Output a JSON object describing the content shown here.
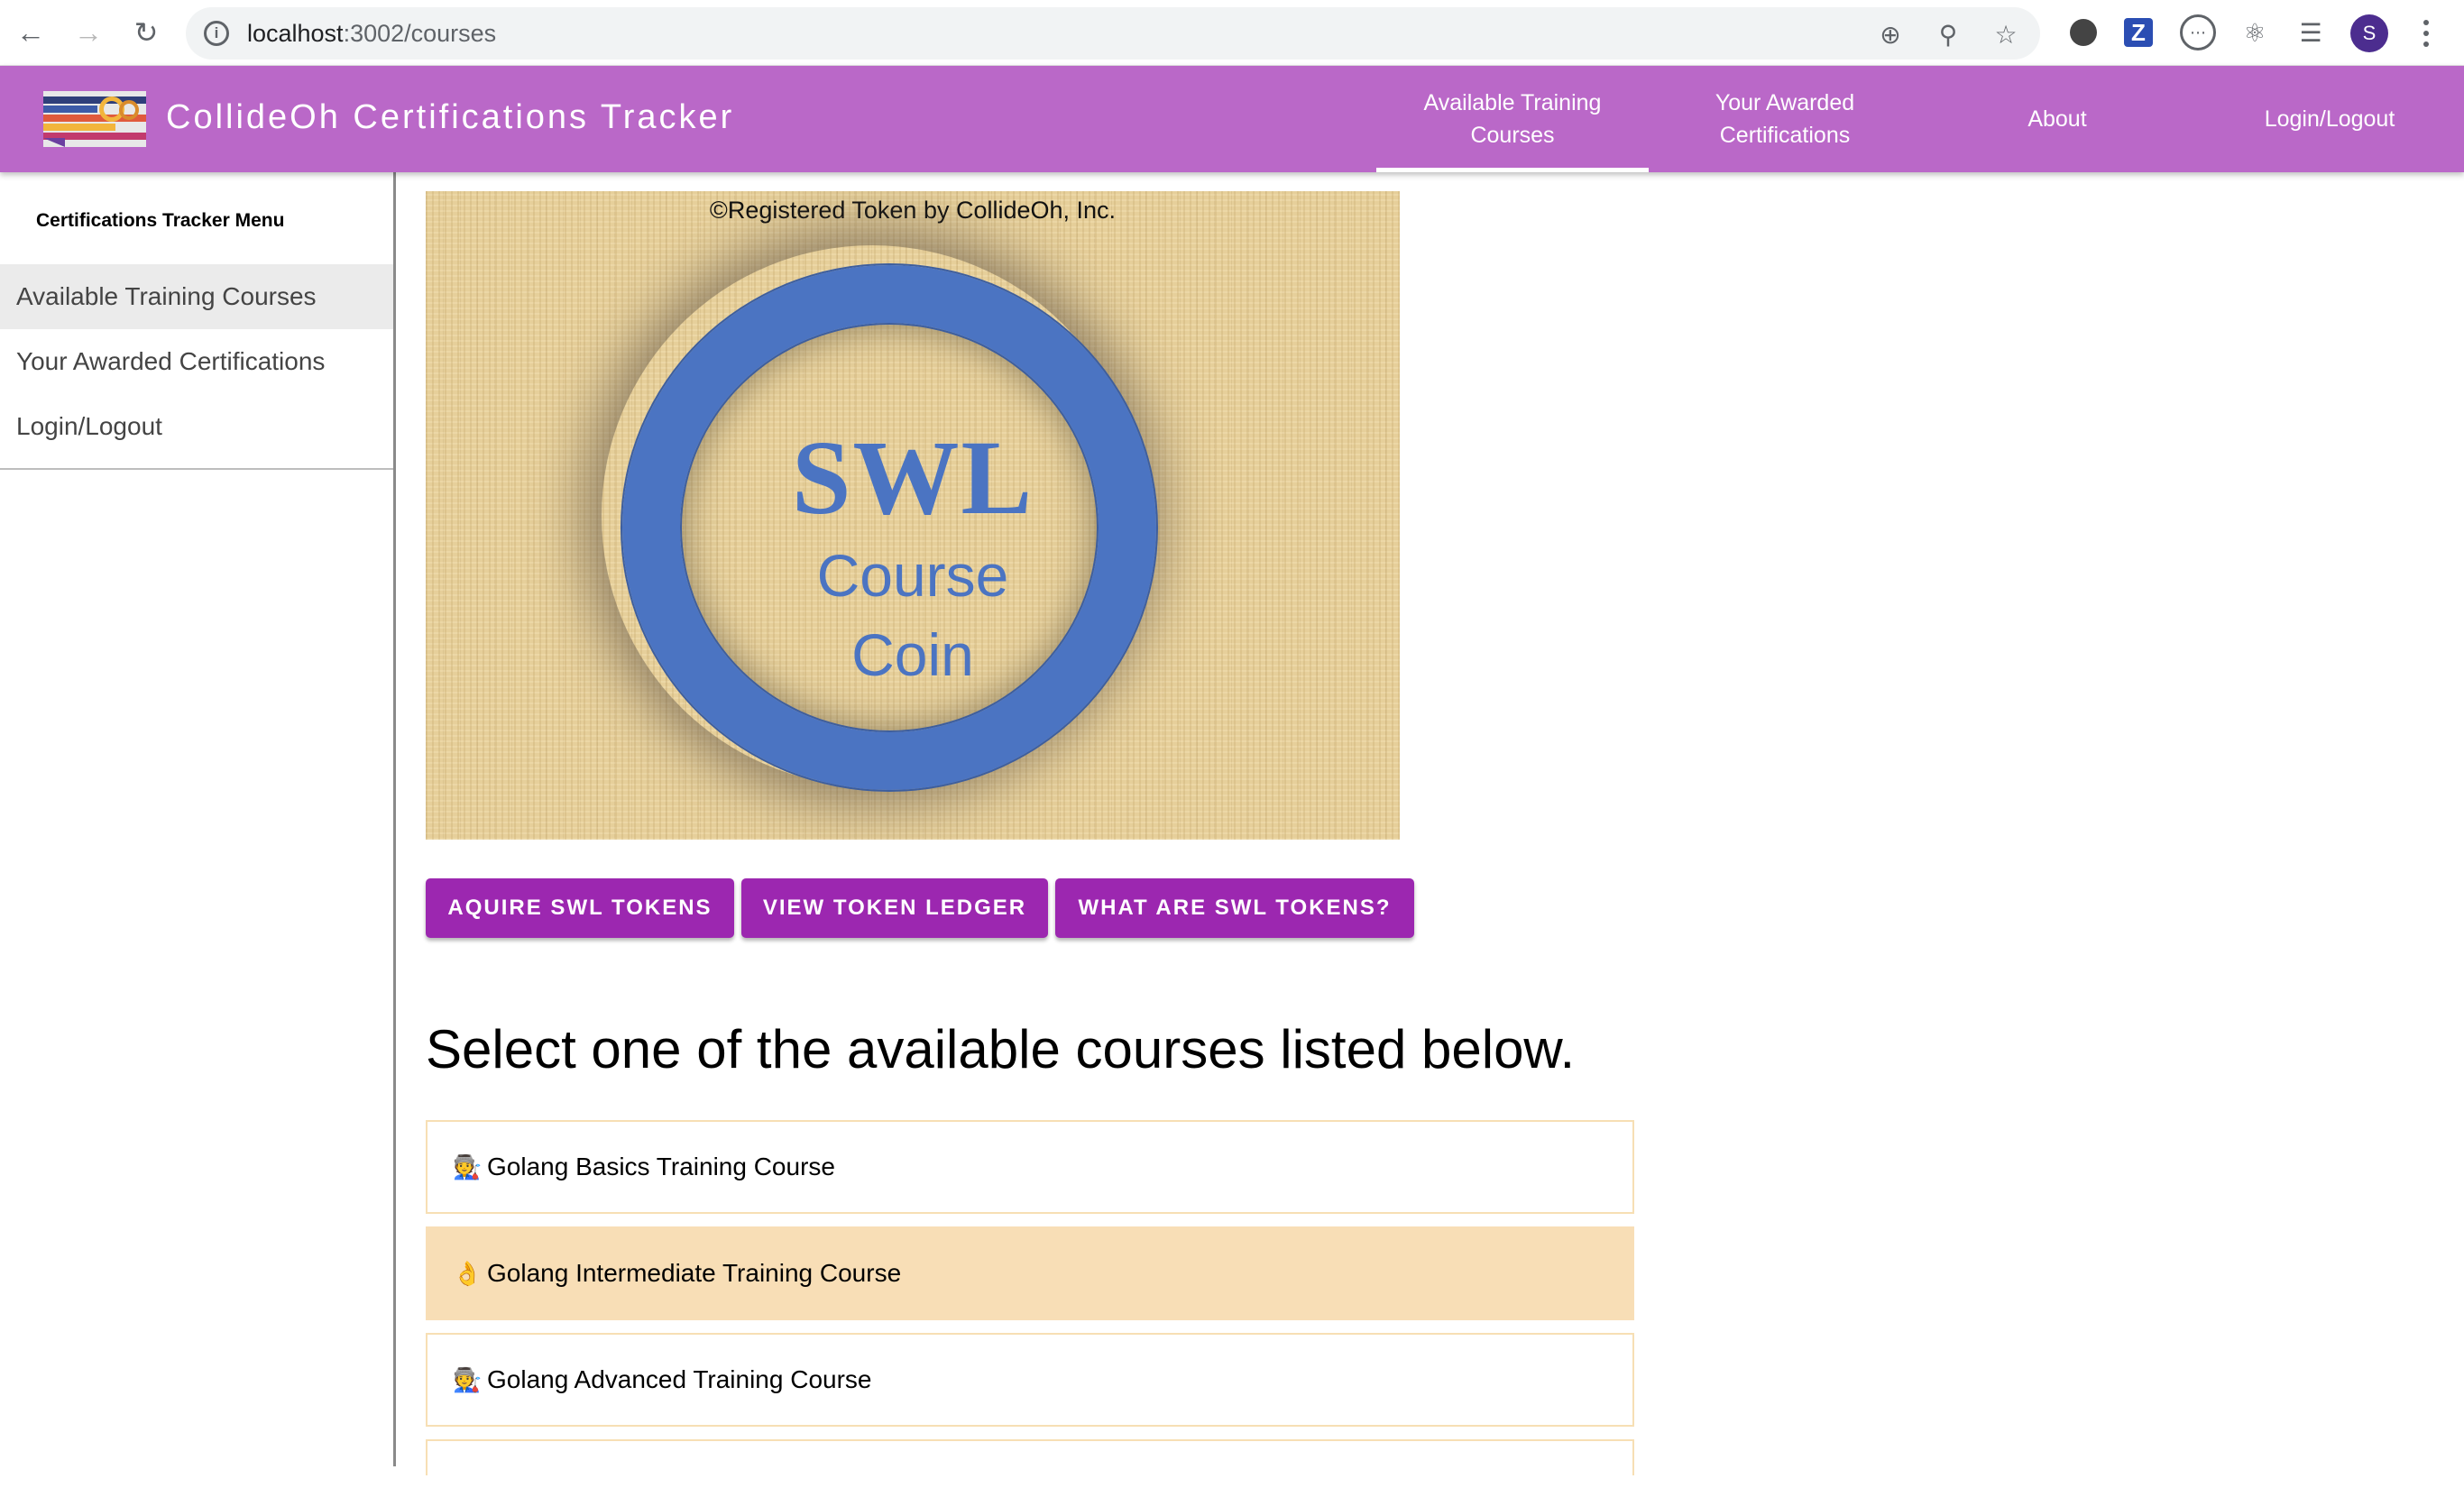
{
  "browser": {
    "url_host": "localhost",
    "url_path": ":3002/courses",
    "profile_initial": "S",
    "extension_z_label": "Z"
  },
  "app_bar": {
    "title": "CollideOh Certifications Tracker",
    "tabs": [
      {
        "label": "Available Training Courses",
        "active": true
      },
      {
        "label": "Your Awarded Certifications",
        "active": false
      },
      {
        "label": "About",
        "active": false
      },
      {
        "label": "Login/Logout",
        "active": false
      }
    ],
    "background_color": "#ba68c8"
  },
  "sidebar": {
    "title": "Certifications Tracker Menu",
    "items": [
      {
        "label": "Available Training Courses",
        "selected": true
      },
      {
        "label": "Your Awarded Certifications",
        "selected": false
      },
      {
        "label": "Login/Logout",
        "selected": false
      }
    ]
  },
  "token_image": {
    "caption": "©Registered Token by CollideOh, Inc.",
    "line1": "SWL",
    "line2": "Course",
    "line3": "Coin",
    "coin_color": "#4b74c2"
  },
  "actions": {
    "acquire_label": "AQUIRE SWL TOKENS",
    "ledger_label": "VIEW TOKEN LEDGER",
    "what_label": "WHAT ARE SWL TOKENS?",
    "button_color": "#9c27b0"
  },
  "main": {
    "heading": "Select one of the available courses listed below.",
    "courses": [
      {
        "icon": "🧑‍🏭",
        "label": "Golang Basics Training Course",
        "highlighted": false
      },
      {
        "icon": "👌",
        "label": "Golang Intermediate Training Course",
        "highlighted": true
      },
      {
        "icon": "🧑‍🏭",
        "label": "Golang Advanced Training Course",
        "highlighted": false
      }
    ]
  }
}
